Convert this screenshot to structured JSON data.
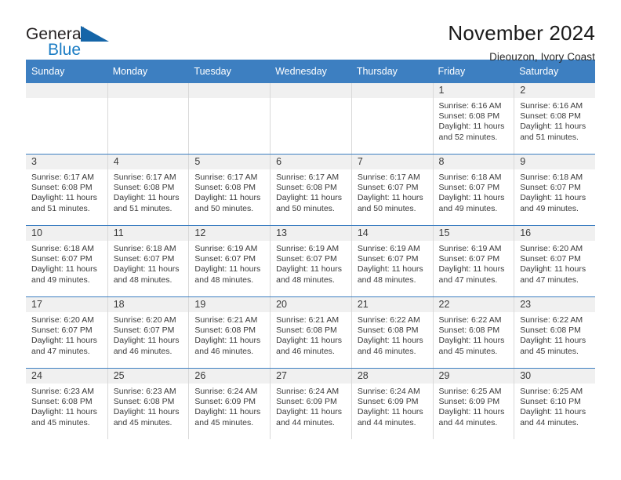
{
  "brand": {
    "name_part1": "General",
    "name_part2": "Blue",
    "triangle_color": "#1565a8",
    "blue_text_color": "#1a7cc4"
  },
  "header": {
    "title": "November 2024",
    "location": "Dieouzon, Ivory Coast",
    "header_band_color": "#3d7fc1",
    "daynum_band_color": "#f0f0f0"
  },
  "weekday_headers": [
    "Sunday",
    "Monday",
    "Tuesday",
    "Wednesday",
    "Thursday",
    "Friday",
    "Saturday"
  ],
  "weeks": [
    [
      {
        "day": "",
        "sunrise": "",
        "sunset": "",
        "daylight_line1": "",
        "daylight_line2": "",
        "empty": true
      },
      {
        "day": "",
        "sunrise": "",
        "sunset": "",
        "daylight_line1": "",
        "daylight_line2": "",
        "empty": true
      },
      {
        "day": "",
        "sunrise": "",
        "sunset": "",
        "daylight_line1": "",
        "daylight_line2": "",
        "empty": true
      },
      {
        "day": "",
        "sunrise": "",
        "sunset": "",
        "daylight_line1": "",
        "daylight_line2": "",
        "empty": true
      },
      {
        "day": "",
        "sunrise": "",
        "sunset": "",
        "daylight_line1": "",
        "daylight_line2": "",
        "empty": true
      },
      {
        "day": "1",
        "sunrise": "Sunrise: 6:16 AM",
        "sunset": "Sunset: 6:08 PM",
        "daylight_line1": "Daylight: 11 hours",
        "daylight_line2": "and 52 minutes."
      },
      {
        "day": "2",
        "sunrise": "Sunrise: 6:16 AM",
        "sunset": "Sunset: 6:08 PM",
        "daylight_line1": "Daylight: 11 hours",
        "daylight_line2": "and 51 minutes."
      }
    ],
    [
      {
        "day": "3",
        "sunrise": "Sunrise: 6:17 AM",
        "sunset": "Sunset: 6:08 PM",
        "daylight_line1": "Daylight: 11 hours",
        "daylight_line2": "and 51 minutes."
      },
      {
        "day": "4",
        "sunrise": "Sunrise: 6:17 AM",
        "sunset": "Sunset: 6:08 PM",
        "daylight_line1": "Daylight: 11 hours",
        "daylight_line2": "and 51 minutes."
      },
      {
        "day": "5",
        "sunrise": "Sunrise: 6:17 AM",
        "sunset": "Sunset: 6:08 PM",
        "daylight_line1": "Daylight: 11 hours",
        "daylight_line2": "and 50 minutes."
      },
      {
        "day": "6",
        "sunrise": "Sunrise: 6:17 AM",
        "sunset": "Sunset: 6:08 PM",
        "daylight_line1": "Daylight: 11 hours",
        "daylight_line2": "and 50 minutes."
      },
      {
        "day": "7",
        "sunrise": "Sunrise: 6:17 AM",
        "sunset": "Sunset: 6:07 PM",
        "daylight_line1": "Daylight: 11 hours",
        "daylight_line2": "and 50 minutes."
      },
      {
        "day": "8",
        "sunrise": "Sunrise: 6:18 AM",
        "sunset": "Sunset: 6:07 PM",
        "daylight_line1": "Daylight: 11 hours",
        "daylight_line2": "and 49 minutes."
      },
      {
        "day": "9",
        "sunrise": "Sunrise: 6:18 AM",
        "sunset": "Sunset: 6:07 PM",
        "daylight_line1": "Daylight: 11 hours",
        "daylight_line2": "and 49 minutes."
      }
    ],
    [
      {
        "day": "10",
        "sunrise": "Sunrise: 6:18 AM",
        "sunset": "Sunset: 6:07 PM",
        "daylight_line1": "Daylight: 11 hours",
        "daylight_line2": "and 49 minutes."
      },
      {
        "day": "11",
        "sunrise": "Sunrise: 6:18 AM",
        "sunset": "Sunset: 6:07 PM",
        "daylight_line1": "Daylight: 11 hours",
        "daylight_line2": "and 48 minutes."
      },
      {
        "day": "12",
        "sunrise": "Sunrise: 6:19 AM",
        "sunset": "Sunset: 6:07 PM",
        "daylight_line1": "Daylight: 11 hours",
        "daylight_line2": "and 48 minutes."
      },
      {
        "day": "13",
        "sunrise": "Sunrise: 6:19 AM",
        "sunset": "Sunset: 6:07 PM",
        "daylight_line1": "Daylight: 11 hours",
        "daylight_line2": "and 48 minutes."
      },
      {
        "day": "14",
        "sunrise": "Sunrise: 6:19 AM",
        "sunset": "Sunset: 6:07 PM",
        "daylight_line1": "Daylight: 11 hours",
        "daylight_line2": "and 48 minutes."
      },
      {
        "day": "15",
        "sunrise": "Sunrise: 6:19 AM",
        "sunset": "Sunset: 6:07 PM",
        "daylight_line1": "Daylight: 11 hours",
        "daylight_line2": "and 47 minutes."
      },
      {
        "day": "16",
        "sunrise": "Sunrise: 6:20 AM",
        "sunset": "Sunset: 6:07 PM",
        "daylight_line1": "Daylight: 11 hours",
        "daylight_line2": "and 47 minutes."
      }
    ],
    [
      {
        "day": "17",
        "sunrise": "Sunrise: 6:20 AM",
        "sunset": "Sunset: 6:07 PM",
        "daylight_line1": "Daylight: 11 hours",
        "daylight_line2": "and 47 minutes."
      },
      {
        "day": "18",
        "sunrise": "Sunrise: 6:20 AM",
        "sunset": "Sunset: 6:07 PM",
        "daylight_line1": "Daylight: 11 hours",
        "daylight_line2": "and 46 minutes."
      },
      {
        "day": "19",
        "sunrise": "Sunrise: 6:21 AM",
        "sunset": "Sunset: 6:08 PM",
        "daylight_line1": "Daylight: 11 hours",
        "daylight_line2": "and 46 minutes."
      },
      {
        "day": "20",
        "sunrise": "Sunrise: 6:21 AM",
        "sunset": "Sunset: 6:08 PM",
        "daylight_line1": "Daylight: 11 hours",
        "daylight_line2": "and 46 minutes."
      },
      {
        "day": "21",
        "sunrise": "Sunrise: 6:22 AM",
        "sunset": "Sunset: 6:08 PM",
        "daylight_line1": "Daylight: 11 hours",
        "daylight_line2": "and 46 minutes."
      },
      {
        "day": "22",
        "sunrise": "Sunrise: 6:22 AM",
        "sunset": "Sunset: 6:08 PM",
        "daylight_line1": "Daylight: 11 hours",
        "daylight_line2": "and 45 minutes."
      },
      {
        "day": "23",
        "sunrise": "Sunrise: 6:22 AM",
        "sunset": "Sunset: 6:08 PM",
        "daylight_line1": "Daylight: 11 hours",
        "daylight_line2": "and 45 minutes."
      }
    ],
    [
      {
        "day": "24",
        "sunrise": "Sunrise: 6:23 AM",
        "sunset": "Sunset: 6:08 PM",
        "daylight_line1": "Daylight: 11 hours",
        "daylight_line2": "and 45 minutes."
      },
      {
        "day": "25",
        "sunrise": "Sunrise: 6:23 AM",
        "sunset": "Sunset: 6:08 PM",
        "daylight_line1": "Daylight: 11 hours",
        "daylight_line2": "and 45 minutes."
      },
      {
        "day": "26",
        "sunrise": "Sunrise: 6:24 AM",
        "sunset": "Sunset: 6:09 PM",
        "daylight_line1": "Daylight: 11 hours",
        "daylight_line2": "and 45 minutes."
      },
      {
        "day": "27",
        "sunrise": "Sunrise: 6:24 AM",
        "sunset": "Sunset: 6:09 PM",
        "daylight_line1": "Daylight: 11 hours",
        "daylight_line2": "and 44 minutes."
      },
      {
        "day": "28",
        "sunrise": "Sunrise: 6:24 AM",
        "sunset": "Sunset: 6:09 PM",
        "daylight_line1": "Daylight: 11 hours",
        "daylight_line2": "and 44 minutes."
      },
      {
        "day": "29",
        "sunrise": "Sunrise: 6:25 AM",
        "sunset": "Sunset: 6:09 PM",
        "daylight_line1": "Daylight: 11 hours",
        "daylight_line2": "and 44 minutes."
      },
      {
        "day": "30",
        "sunrise": "Sunrise: 6:25 AM",
        "sunset": "Sunset: 6:10 PM",
        "daylight_line1": "Daylight: 11 hours",
        "daylight_line2": "and 44 minutes."
      }
    ]
  ]
}
